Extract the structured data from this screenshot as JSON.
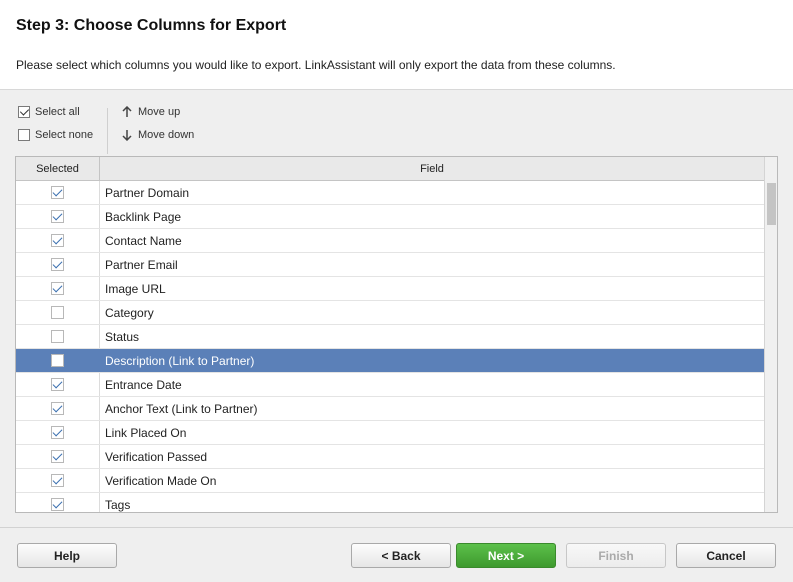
{
  "header": {
    "title": "Step 3: Choose Columns for Export",
    "subtitle": "Please select which columns you would like to export. LinkAssistant will only export the data from these columns."
  },
  "toolbar": {
    "select_all": "Select all",
    "select_none": "Select none",
    "move_up": "Move up",
    "move_down": "Move down"
  },
  "table": {
    "columns": [
      "Selected",
      "Field"
    ],
    "rows": [
      {
        "field": "Partner Domain",
        "checked": true
      },
      {
        "field": "Backlink Page",
        "checked": true
      },
      {
        "field": "Contact Name",
        "checked": true
      },
      {
        "field": "Partner Email",
        "checked": true
      },
      {
        "field": "Image URL",
        "checked": true
      },
      {
        "field": "Category",
        "checked": false
      },
      {
        "field": "Status",
        "checked": false
      },
      {
        "field": "Description (Link to Partner)",
        "checked": false,
        "selected": true
      },
      {
        "field": "Entrance Date",
        "checked": true
      },
      {
        "field": "Anchor Text (Link to Partner)",
        "checked": true
      },
      {
        "field": "Link Placed On",
        "checked": true
      },
      {
        "field": "Verification Passed",
        "checked": true
      },
      {
        "field": "Verification Made On",
        "checked": true
      },
      {
        "field": "Tags",
        "checked": true
      }
    ]
  },
  "footer": {
    "help": "Help",
    "back": "< Back",
    "next": "Next >",
    "finish": "Finish",
    "cancel": "Cancel"
  },
  "colors": {
    "selection": "#5b80b8",
    "primary_button": "#4caf3c"
  }
}
